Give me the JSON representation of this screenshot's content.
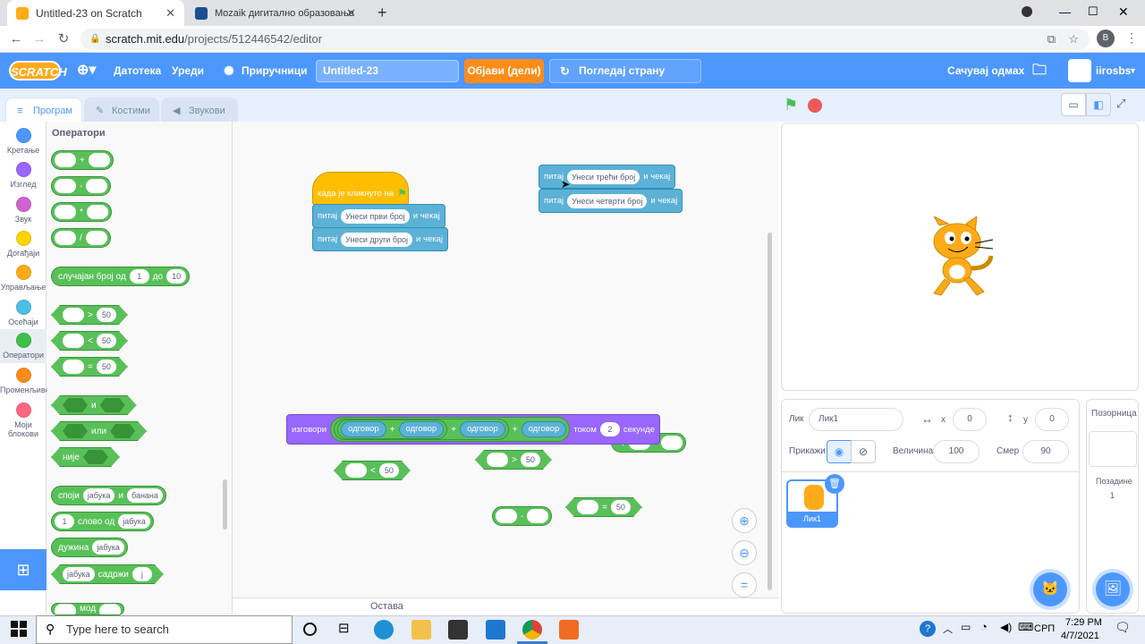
{
  "browser": {
    "tabs": [
      {
        "title": "Untitled-23 on Scratch",
        "active": true
      },
      {
        "title": "Mozaik дигитално образовање",
        "active": false
      }
    ],
    "url_host": "scratch.mit.edu",
    "url_path": "/projects/512446542/editor",
    "profile_initial": "B"
  },
  "menubar": {
    "logo": "SCRATCH",
    "file": "Датотека",
    "edit": "Уреди",
    "tutorials": "Приручници",
    "project_title": "Untitled-23",
    "share": "Објави (дели)",
    "see_project": "Погледај страну пројекта",
    "save_now": "Сачувај одмах",
    "username": "iirosbs"
  },
  "editor_tabs": [
    "Програм",
    "Костими",
    "Звукови"
  ],
  "categories": [
    {
      "label": "Кретање",
      "color": "#4c97ff"
    },
    {
      "label": "Изглед",
      "color": "#9966ff"
    },
    {
      "label": "Звук",
      "color": "#cf63cf"
    },
    {
      "label": "Догађаји",
      "color": "#ffd500"
    },
    {
      "label": "Управљање",
      "color": "#ffab19"
    },
    {
      "label": "Осећаји",
      "color": "#4cbfe6"
    },
    {
      "label": "Оператори",
      "color": "#40bf4a"
    },
    {
      "label": "Променљиве",
      "color": "#ff8c1a"
    },
    {
      "label": "Моји блокови",
      "color": "#ff6680"
    }
  ],
  "palette": {
    "title": "Оператори",
    "arith_ops": [
      "+",
      "-",
      "*",
      "/"
    ],
    "random": {
      "label1": "случајан број од",
      "from": "1",
      "label2": "до",
      "to": "10"
    },
    "compare": [
      {
        "op": ">",
        "value": "50"
      },
      {
        "op": "<",
        "value": "50"
      },
      {
        "op": "=",
        "value": "50"
      }
    ],
    "logic": [
      "и",
      "или",
      "није"
    ],
    "join": {
      "label": "споји",
      "a": "јабука",
      "and": "и",
      "b": "банана"
    },
    "letter_of": {
      "n": "1",
      "label": "слово од",
      "word": "јабука"
    },
    "length": {
      "label": "дужина",
      "word": "јабука"
    },
    "contains": {
      "word": "јабука",
      "label": "садржи",
      "ch": "ј"
    },
    "mod_partial": "мод"
  },
  "scripts": {
    "hat": {
      "label": "када је кликнуто на"
    },
    "ask1": {
      "label": "питај",
      "input": "Унеси први број",
      "wait": "и чекај"
    },
    "ask2": {
      "label": "питај",
      "input": "Унеси други број",
      "wait": "и чекај"
    },
    "ask3": {
      "label": "питај",
      "input": "Унеси трећи број",
      "wait": "и чекај"
    },
    "ask4": {
      "label": "питај",
      "input": "Унеси четврти број",
      "wait": "и чекај"
    },
    "say": {
      "label": "изговори",
      "answers": [
        "одговор",
        "одговор",
        "одговор",
        "одговор"
      ],
      "plus": "+",
      "for": "током",
      "secs": "2",
      "seconds": "секунде"
    },
    "loose_div_op": "/",
    "loose_mult_op": "*",
    "loose_lt": {
      "op": "<",
      "value": "50"
    },
    "loose_gt": {
      "op": ">",
      "value": "50"
    },
    "loose_eq": {
      "op": "=",
      "value": "50"
    },
    "loose_minus": "-"
  },
  "backpack": "Остава",
  "sprite": {
    "label_sprite": "Лик",
    "name": "Лик1",
    "x_label": "x",
    "x": "0",
    "y_label": "y",
    "y": "0",
    "show_label": "Прикажи",
    "size_label": "Величина",
    "size": "100",
    "direction_label": "Смер",
    "direction": "90",
    "thumb_name": "Лик1"
  },
  "stage_panel": {
    "title": "Позорница",
    "backdrops_label": "Позадине",
    "backdrops_count": "1"
  },
  "taskbar": {
    "search_placeholder": "Type here to search",
    "lang": "СРП",
    "time": "7:29 PM",
    "date": "4/7/2021"
  }
}
